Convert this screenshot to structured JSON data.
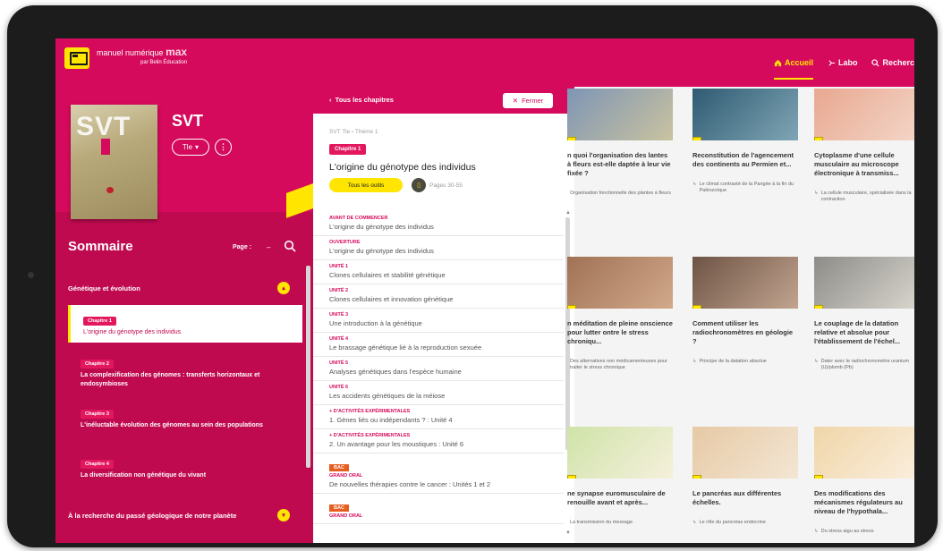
{
  "brand": {
    "name": "manuel numérique",
    "accent": "max",
    "publisher": "par Belin Éducation"
  },
  "nav": {
    "home": "Accueil",
    "lab": "Labo",
    "search": "Recherc"
  },
  "book": {
    "cover_title": "SVT",
    "cover_level": "T",
    "subject": "SVT",
    "level": "Tle",
    "level_arrow": "▾",
    "more": "⋮"
  },
  "sommaire": {
    "title": "Sommaire",
    "page_label": "Page :",
    "page_value": "–",
    "themes": [
      {
        "label": "Génétique et évolution",
        "toggle": "▴"
      },
      {
        "label": "À la recherche du passé géologique de notre planète",
        "toggle": "▾"
      }
    ],
    "chapters": [
      {
        "tag": "Chapitre 1",
        "title": "L'origine du génotype des individus"
      },
      {
        "tag": "Chapitre 2",
        "title": "La complexification des génomes : transferts horizontaux et endosymbioses"
      },
      {
        "tag": "Chapitre 3",
        "title": "L'inéluctable évolution des génomes au sein des populations"
      },
      {
        "tag": "Chapitre 4",
        "title": "La diversification non génétique du vivant"
      }
    ]
  },
  "detail": {
    "back": "Tous les chapitres",
    "back_arrow": "‹",
    "close": "Fermer",
    "close_icon": "✕",
    "breadcrumb": "SVT Tle › Thème 1",
    "chapter_tag": "Chapitre 1",
    "title": "L'origine du génotype des individus",
    "tools": "Tous les outils",
    "pages": "Pages 30-55",
    "toc": [
      {
        "kicker": "Avant de commencer",
        "text": "L'origine du génotype des individus"
      },
      {
        "kicker": "Ouverture",
        "text": "L'origine du génotype des individus"
      },
      {
        "kicker": "Unité 1",
        "text": "Clones cellulaires et stabilité génétique"
      },
      {
        "kicker": "Unité 2",
        "text": "Clones cellulaires et innovation génétique"
      },
      {
        "kicker": "Unité 3",
        "text": "Une introduction à la génétique"
      },
      {
        "kicker": "Unité 4",
        "text": "Le brassage génétique lié à la reproduction sexuée"
      },
      {
        "kicker": "Unité 5",
        "text": "Analyses génétiques dans l'espèce humaine"
      },
      {
        "kicker": "Unité 6",
        "text": "Les accidents génétiques de la méiose"
      },
      {
        "kicker": "+ D'activités expérimentales",
        "text": "1. Gènes liés ou indépendants ? : Unité 4"
      },
      {
        "kicker": "+ D'activités expérimentales",
        "text": "2. Un avantage pour les moustiques : Unité 6"
      },
      {
        "badge": "BAC",
        "kicker": "Grand oral",
        "text": "De nouvelles thérapies contre le cancer : Unités 1 et 2"
      },
      {
        "badge": "BAC",
        "kicker": "Grand oral",
        "text": ""
      }
    ]
  },
  "cards": [
    {
      "title": "n quoi l'organisation des lantes à fleurs est-elle daptée à leur vie fixée ?",
      "sub": "Organisation fonctionnelle des plantes à fleurs",
      "arrow": "",
      "bg": "#7e95b5",
      "bg2": "#c9c3a0"
    },
    {
      "title": "Reconstitution de l'agencement des continents au Permien et...",
      "sub": "Le climat contrasté de la Pangée à la fin du Paléozoïque",
      "arrow": "↳",
      "bg": "#2f5a72",
      "bg2": "#7fa6b5"
    },
    {
      "title": "Cytoplasme d'une cellule musculaire au microscope électronique à transmiss...",
      "sub": "La cellule musculaire, spécialisée dans la contraction",
      "arrow": "↳",
      "bg": "#e8a890",
      "bg2": "#f4d6c8"
    },
    {
      "title": "n méditation de pleine onscience pour lutter ontre le stress chroniqu...",
      "sub": "Des alternatives non médicamenteuses pour traiter le stress chronique",
      "arrow": "",
      "bg": "#a07256",
      "bg2": "#d2a98a"
    },
    {
      "title": "Comment utiliser les radiochronomètres en géologie ?",
      "sub": "Principe de la datation absolue",
      "arrow": "↳",
      "bg": "#6e5446",
      "bg2": "#c2a48f"
    },
    {
      "title": "Le couplage de la datation relative et absolue pour l'établissement de l'échel...",
      "sub": "Dater avec le radiochronomètre uranium (U)/plomb (Pb)",
      "arrow": "↳",
      "bg": "#8d8c88",
      "bg2": "#d9d6ce"
    },
    {
      "title": "ne synapse euromusculaire de renouille avant et après...",
      "sub": "La transmission du message",
      "arrow": "",
      "bg": "#cfe3a8",
      "bg2": "#f5f0dc"
    },
    {
      "title": "Le pancréas aux différentes échelles.",
      "sub": "Le rôle du pancréas endocrine",
      "arrow": "↳",
      "bg": "#e7c9a5",
      "bg2": "#f3e6d4"
    },
    {
      "title": "Des modifications des mécanismes régulateurs au niveau de l'hypothala...",
      "sub": "Du stress aigu au stress",
      "arrow": "↳",
      "bg": "#f0d6a8",
      "bg2": "#fbeede"
    }
  ]
}
